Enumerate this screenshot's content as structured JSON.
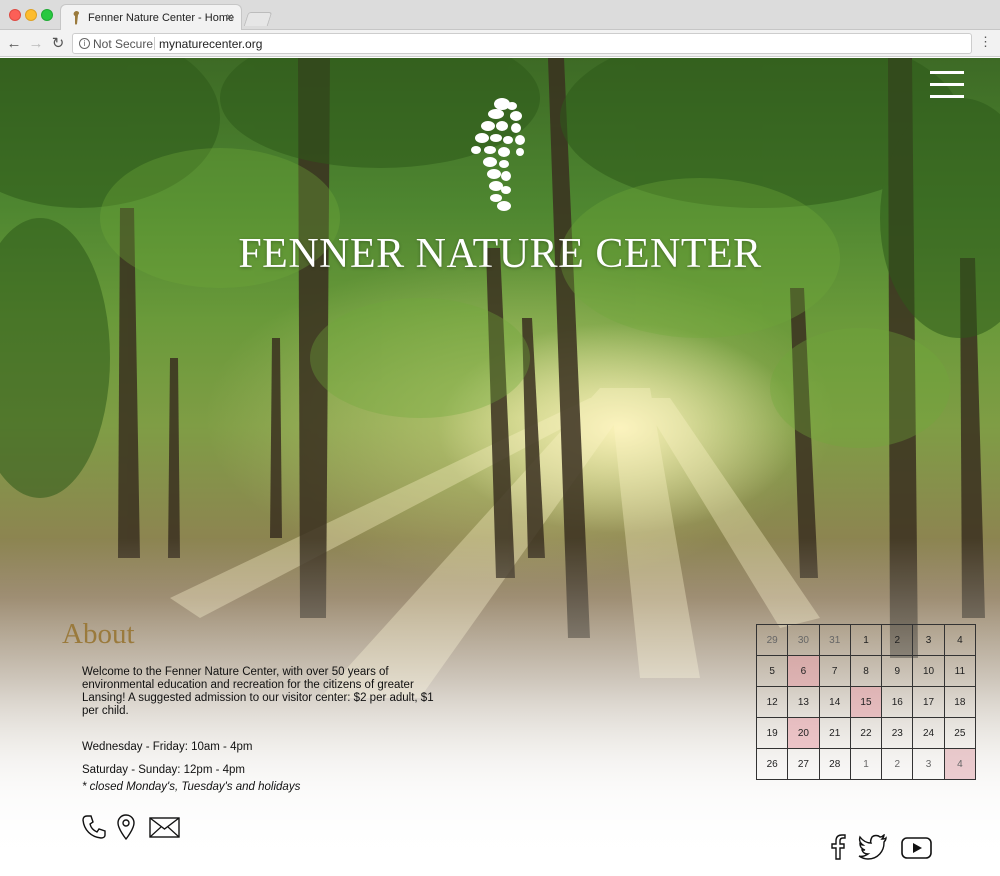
{
  "browser": {
    "tab_title": "Fenner Nature Center - Home",
    "tab_close": "×",
    "security_label": "Not Secure",
    "url": "mynaturecenter.org",
    "back": "←",
    "forward": "→",
    "reload": "↻",
    "menu": "⋮",
    "info": "i"
  },
  "header": {
    "site_title": "FENNER NATURE CENTER",
    "logo_icon": "stone-figure-logo-icon",
    "menu_icon": "hamburger-menu-icon"
  },
  "about": {
    "heading": "About",
    "text": "Welcome to the Fenner Nature Center, with over 50 years of environmental education and recreation for the citizens of greater Lansing! A suggested admission to our visitor center: $2 per adult, $1 per child.",
    "hours_weekday": "Wednesday - Friday: 10am - 4pm",
    "hours_weekend": "Saturday - Sunday: 12pm - 4pm",
    "closed_note": "* closed Monday's, Tuesday's and holidays"
  },
  "contact_icons": [
    "phone-icon",
    "map-pin-icon",
    "mail-icon"
  ],
  "social_icons": [
    "facebook-icon",
    "twitter-icon",
    "youtube-icon"
  ],
  "calendar": {
    "weeks": [
      [
        {
          "d": "29",
          "m": true
        },
        {
          "d": "30",
          "m": true
        },
        {
          "d": "31",
          "m": true
        },
        {
          "d": "1"
        },
        {
          "d": "2"
        },
        {
          "d": "3"
        },
        {
          "d": "4"
        }
      ],
      [
        {
          "d": "5"
        },
        {
          "d": "6",
          "h": true
        },
        {
          "d": "7"
        },
        {
          "d": "8"
        },
        {
          "d": "9"
        },
        {
          "d": "10"
        },
        {
          "d": "11"
        }
      ],
      [
        {
          "d": "12"
        },
        {
          "d": "13"
        },
        {
          "d": "14"
        },
        {
          "d": "15",
          "h": true
        },
        {
          "d": "16"
        },
        {
          "d": "17"
        },
        {
          "d": "18"
        }
      ],
      [
        {
          "d": "19"
        },
        {
          "d": "20",
          "h": true
        },
        {
          "d": "21"
        },
        {
          "d": "22"
        },
        {
          "d": "23"
        },
        {
          "d": "24"
        },
        {
          "d": "25"
        }
      ],
      [
        {
          "d": "26"
        },
        {
          "d": "27"
        },
        {
          "d": "28"
        },
        {
          "d": "1",
          "m": true
        },
        {
          "d": "2",
          "m": true
        },
        {
          "d": "3",
          "m": true
        },
        {
          "d": "4",
          "m": true,
          "h": true
        }
      ]
    ],
    "highlight_color": "#e8a0aa"
  },
  "colors": {
    "about_heading": "#9a7a3c",
    "title": "#ffffff"
  }
}
